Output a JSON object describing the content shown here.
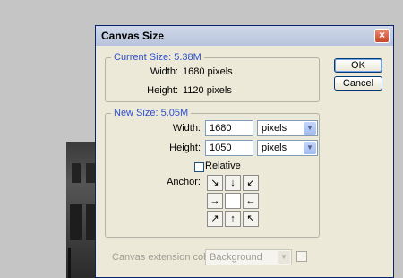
{
  "dialog": {
    "title": "Canvas Size",
    "close_glyph": "×",
    "ok_label": "OK",
    "cancel_label": "Cancel"
  },
  "current_size": {
    "legend": "Current Size: 5.38M",
    "width_label": "Width:",
    "width_value": "1680 pixels",
    "height_label": "Height:",
    "height_value": "1120 pixels"
  },
  "new_size": {
    "legend": "New Size: 5.05M",
    "width_label": "Width:",
    "width_value": "1680",
    "width_unit": "pixels",
    "height_label": "Height:",
    "height_value": "1050",
    "height_unit": "pixels",
    "relative_label": "Relative",
    "relative_checked": false,
    "anchor_label": "Anchor:",
    "anchor_arrows": [
      "↘",
      "↓",
      "↙",
      "→",
      "",
      "←",
      "↗",
      "↑",
      "↖"
    ]
  },
  "extension": {
    "label": "Canvas extension color:",
    "value": "Background"
  },
  "icons": {
    "dropdown": "chevron-down-icon",
    "close": "close-icon"
  },
  "colors": {
    "legend_text": "#2c4fd0",
    "dialog_bg": "#ece9d8",
    "title_bar": "#b8c4dc",
    "close_button": "#c8452a"
  }
}
